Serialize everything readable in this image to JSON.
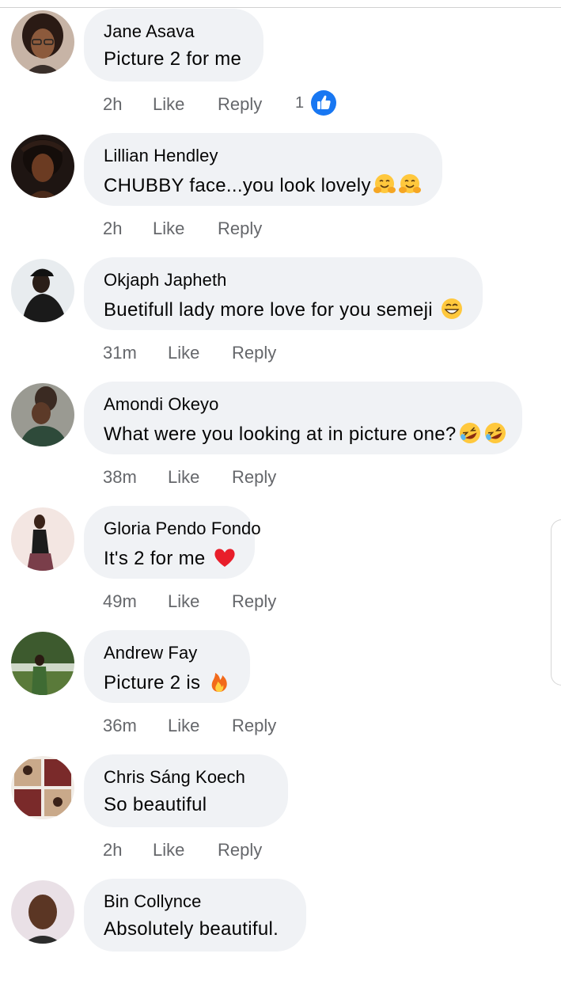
{
  "comments": [
    {
      "author": "Jane Asava",
      "text": "Picture 2 for me",
      "emoji": [],
      "time": "2h",
      "like_label": "Like",
      "reply_label": "Reply",
      "reaction_count": "1",
      "reaction_icon": "like-thumb-icon",
      "avatar_colors": [
        "#2a1a14",
        "#8c5a3c"
      ]
    },
    {
      "author": "Lillian Hendley",
      "text": "CHUBBY face...you look lovely",
      "emoji": [
        "hugging-face-icon",
        "hugging-face-icon"
      ],
      "time": "2h",
      "like_label": "Like",
      "reply_label": "Reply",
      "avatar_colors": [
        "#140d0a",
        "#6b3b22"
      ]
    },
    {
      "author": "Okjaph Japheth",
      "text": "Buetifull lady more love for you semeji",
      "emoji": [
        "grinning-face-icon"
      ],
      "time": "31m",
      "like_label": "Like",
      "reply_label": "Reply",
      "avatar_colors": [
        "#e8ecef",
        "#1a1a1a"
      ]
    },
    {
      "author": "Amondi Okeyo",
      "text": "What were you looking at in picture one?",
      "emoji": [
        "rofl-face-icon",
        "rofl-face-icon"
      ],
      "time": "38m",
      "like_label": "Like",
      "reply_label": "Reply",
      "avatar_colors": [
        "#9a9a92",
        "#2e4a3a"
      ]
    },
    {
      "author": "Gloria Pendo Fondo",
      "text": "It's 2 for me",
      "emoji": [
        "red-heart-icon"
      ],
      "time": "49m",
      "like_label": "Like",
      "reply_label": "Reply",
      "avatar_colors": [
        "#f3e6e2",
        "#7a3e4a"
      ]
    },
    {
      "author": "Andrew Fay",
      "text": "Picture 2 is",
      "emoji": [
        "fire-icon"
      ],
      "time": "36m",
      "like_label": "Like",
      "reply_label": "Reply",
      "avatar_colors": [
        "#cfd8c8",
        "#3f6b33"
      ]
    },
    {
      "author": "Chris Sáng Koech",
      "text": "So beautiful",
      "emoji": [],
      "time": "2h",
      "like_label": "Like",
      "reply_label": "Reply",
      "avatar_colors": [
        "#c9a98a",
        "#7a2a2a"
      ]
    },
    {
      "author": "Bin Collynce",
      "text": "Absolutely beautiful.",
      "emoji": [],
      "time": "",
      "like_label": "",
      "reply_label": "",
      "avatar_colors": [
        "#e9e0e6",
        "#5b3624"
      ]
    }
  ],
  "colors": {
    "bubble": "#f0f2f5",
    "meta_text": "#65676b",
    "like_blue": "#1877f2"
  }
}
